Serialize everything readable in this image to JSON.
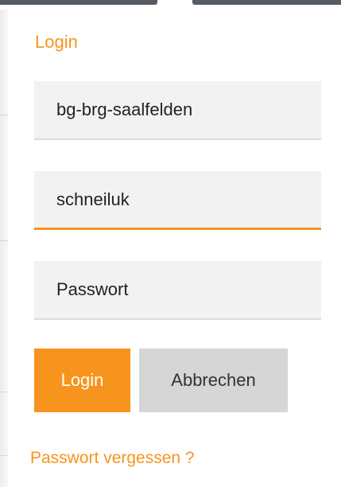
{
  "login": {
    "title": "Login",
    "school_value": "bg-brg-saalfelden",
    "username_value": "schneiluk",
    "password_placeholder": "Passwort",
    "login_button": "Login",
    "cancel_button": "Abbrechen",
    "forgot_link": "Passwort vergessen ?"
  },
  "colors": {
    "accent": "#f7941d",
    "field_background": "#f2f2f2",
    "cancel_background": "#d6d6d6",
    "topbar": "#555b61"
  }
}
